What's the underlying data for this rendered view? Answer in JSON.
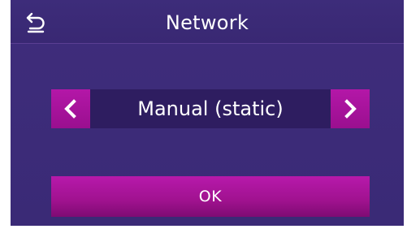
{
  "header": {
    "title": "Network",
    "back_icon": "back-arrow-icon"
  },
  "mode_selector": {
    "value": "Manual (static)",
    "prev_icon": "chevron-left-icon",
    "next_icon": "chevron-right-icon"
  },
  "actions": {
    "ok_label": "OK"
  },
  "colors": {
    "background": "#3f2d7c",
    "selector_background": "#2e1d60",
    "accent": "#b417a8",
    "text": "#ffffff"
  }
}
